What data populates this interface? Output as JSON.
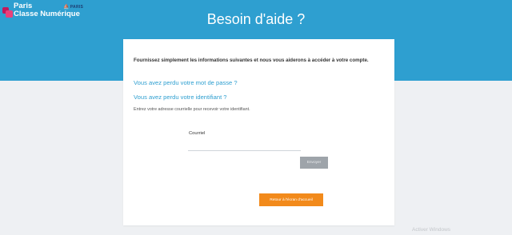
{
  "header": {
    "logo_line1": "Paris",
    "logo_line2": "Classe Numérique",
    "partner_logo_text": "PARIS",
    "partner_logo_icon": "ship-icon",
    "title": "Besoin d'aide ?"
  },
  "colors": {
    "brand_blue": "#2e9fd0",
    "logo_pink": "#e9417a",
    "home_button_orange": "#f28a1b",
    "disabled_button_gray": "#9ea4aa"
  },
  "form": {
    "intro": "Fournissez simplement les informations suivantes et nous vous aiderons à accéder à votre compte.",
    "forgot_password_link": "Vous avez perdu votre mot de passe ?",
    "forgot_identifier_link": "Vous avez perdu votre identifiant ?",
    "hint": "Entrez votre adresse courrielle pour recevoir votre identifiant.",
    "email_label": "Courriel",
    "email_value": "",
    "email_placeholder": "",
    "send_label": "Envoyer",
    "home_label": "Retour à l'écran d'accueil"
  },
  "os_watermark": "Activer Windows"
}
